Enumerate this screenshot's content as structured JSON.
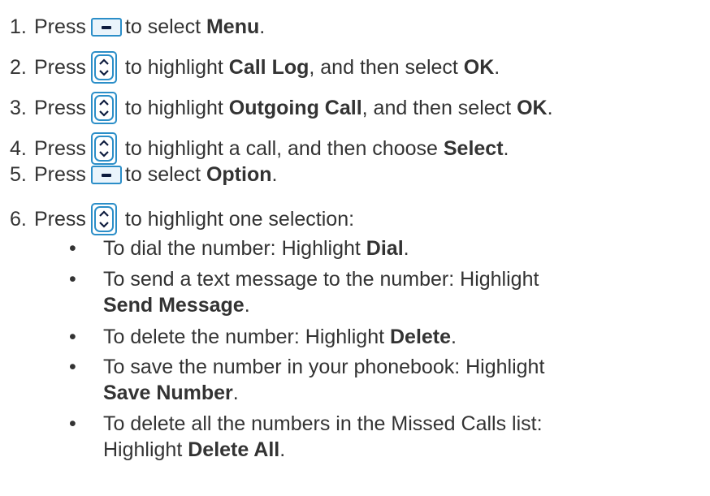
{
  "steps": [
    {
      "num": "1.",
      "press": "Press",
      "key": "soft",
      "pre": "to select ",
      "bold1": "Menu",
      "mid": "",
      "bold2": "",
      "post": "."
    },
    {
      "num": "2.",
      "press": "Press",
      "key": "nav",
      "pre": "to highlight ",
      "bold1": "Call Log",
      "mid": ", and then select ",
      "bold2": "OK",
      "post": "."
    },
    {
      "num": "3.",
      "press": "Press",
      "key": "nav",
      "pre": "to highlight ",
      "bold1": "Outgoing Call",
      "mid": ", and then select ",
      "bold2": "OK",
      "post": "."
    },
    {
      "num": "4.",
      "press": "Press",
      "key": "nav",
      "pre": "to highlight a call, and then choose ",
      "bold1": "Select",
      "mid": "",
      "bold2": "",
      "post": "."
    },
    {
      "num": "5.",
      "press": "Press",
      "key": "soft",
      "pre": "to select ",
      "bold1": "Option",
      "mid": "",
      "bold2": "",
      "post": "."
    },
    {
      "num": "6.",
      "press": "Press",
      "key": "nav",
      "pre": "to highlight one selection:",
      "bold1": "",
      "mid": "",
      "bold2": "",
      "post": ""
    }
  ],
  "bullets": [
    {
      "text": "To dial the number: Highlight ",
      "bold": "Dial",
      "post": "."
    },
    {
      "text": "To send a text message to the number: Highlight",
      "bold": "Send Message",
      "post": "."
    },
    {
      "text": "To delete the number: Highlight ",
      "bold": "Delete",
      "post": "."
    },
    {
      "text": "To save the number in your phonebook: Highlight",
      "bold": "Save Number",
      "post": "."
    },
    {
      "text": "To delete all the numbers in the Missed Calls list:",
      "bold_prefix": "Highlight ",
      "bold": "Delete All",
      "post": "."
    }
  ],
  "bullet_char": "•",
  "colors": {
    "text": "#333333",
    "key_border": "#2b8ec8",
    "key_fill": "#eaf4fb",
    "key_mark": "#0d1b3d"
  }
}
